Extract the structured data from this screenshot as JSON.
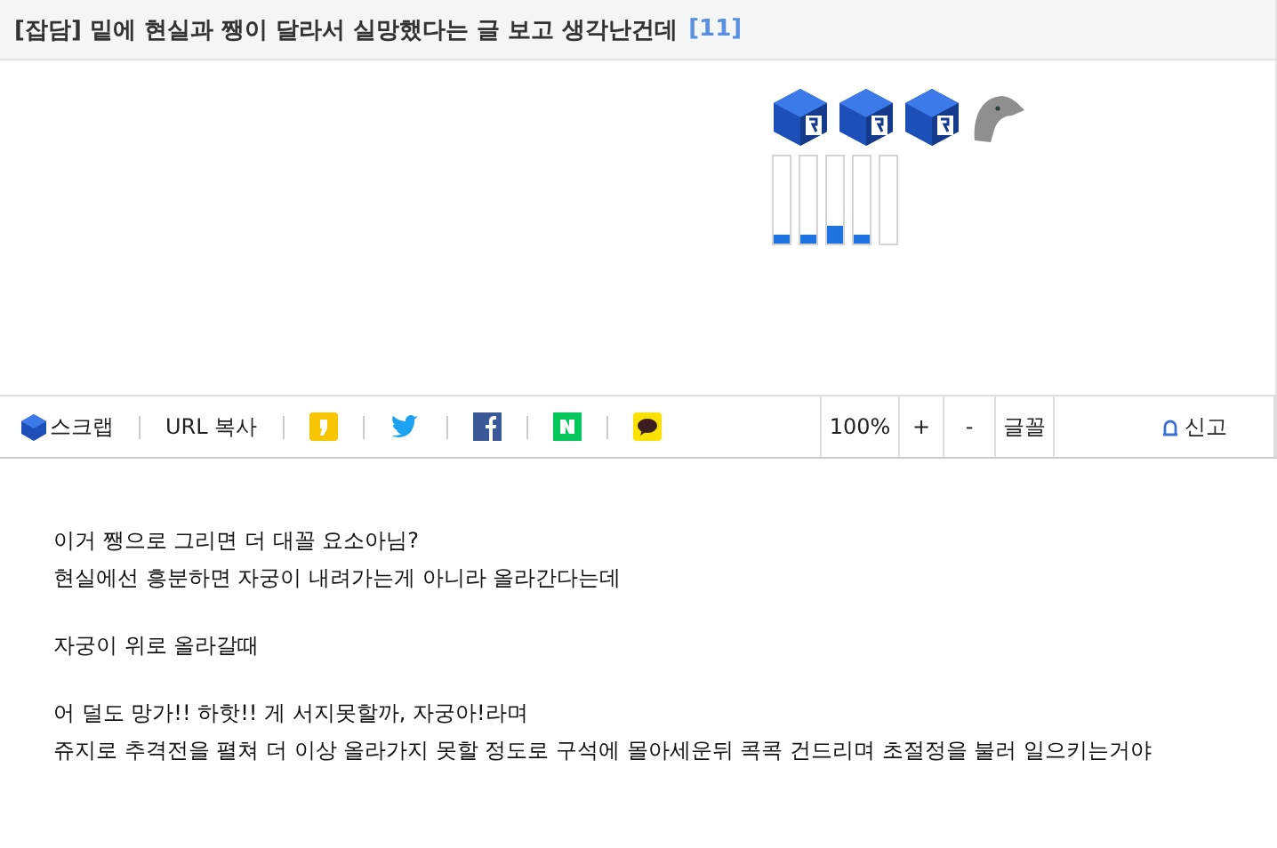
{
  "post": {
    "title": "[잡담] 밑에 현실과 쨍이 달라서 실망했다는 글 보고 생각난건데",
    "comment_count": "[11]"
  },
  "reactions": [
    {
      "kind": "cube"
    },
    {
      "kind": "cube"
    },
    {
      "kind": "cube"
    },
    {
      "kind": "dolphin"
    }
  ],
  "meters": [
    {
      "level": 0.1
    },
    {
      "level": 0.1
    },
    {
      "level": 0.2
    },
    {
      "level": 0.1
    }
  ],
  "toolbar": {
    "scrap": "스크랩",
    "copy_url": "URL 복사",
    "share": [
      {
        "kind": "story"
      },
      {
        "kind": "twitter"
      },
      {
        "kind": "facebook"
      },
      {
        "kind": "naver"
      },
      {
        "kind": "talk"
      }
    ],
    "zoom": "100%",
    "zoom_in": "+",
    "zoom_out": "-",
    "font": "글꼴",
    "report": "신고"
  },
  "paragraphs": [
    [
      "이거 쨍으로 그리면 더 대꼴 요소아님?",
      "현실에선 흥분하면 자궁이 내려가는게 아니라 올라간다는데"
    ],
    [
      "자궁이 위로 올라갈때"
    ],
    [
      "어 덜도 망가!! 하핫!! 게 서지못할까, 자궁아!라며",
      "쥬지로 추격전을 펼쳐 더 이상 올라가지 못할 정도로 구석에 몰아세운뒤 콕콕 건드리며 초절정을 불러 일으키는거야"
    ]
  ]
}
